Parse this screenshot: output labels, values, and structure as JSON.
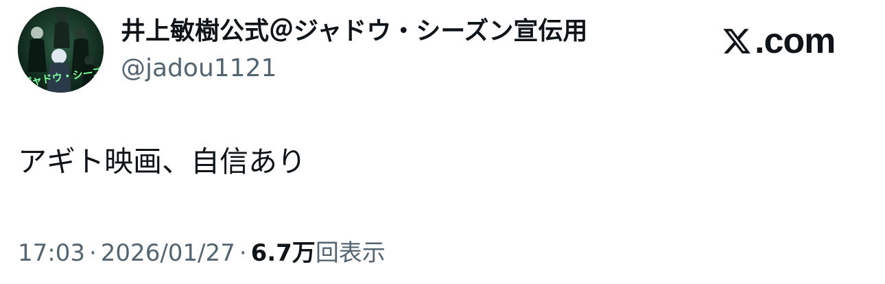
{
  "author": {
    "display_name": "井上敏樹公式＠ジャドウ・シーズン宣伝用",
    "handle": "@jadou1121",
    "avatar_text": "ジャドウ・シーズン"
  },
  "brand": {
    "logo_text": ".com"
  },
  "tweet": {
    "text": "アギト映画、自信あり"
  },
  "meta": {
    "time": "17:03",
    "separator": "·",
    "date": "2026/01/27",
    "views_count": "6.7万",
    "views_label": "回表示"
  },
  "colors": {
    "text_primary": "#0f1419",
    "text_secondary": "#536471",
    "avatar_background": "#0f2a1c",
    "avatar_text": "#7fffa0"
  }
}
